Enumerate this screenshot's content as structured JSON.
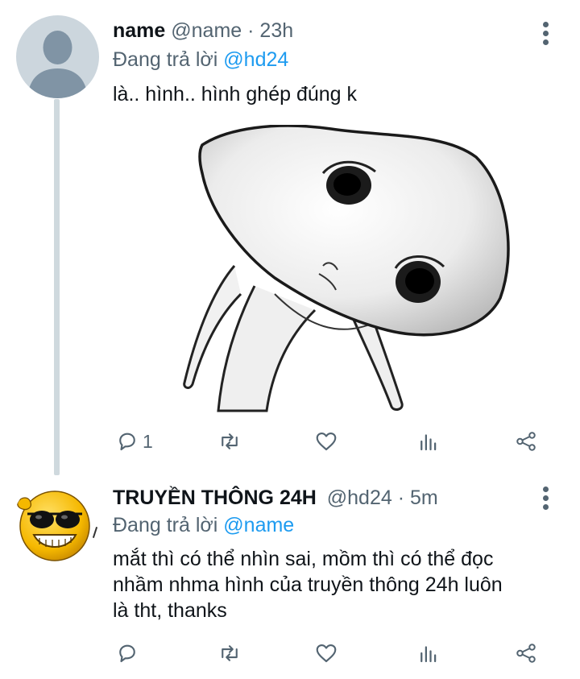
{
  "tweets": [
    {
      "name": "name",
      "handle": "@name",
      "dot": "·",
      "time": "23h",
      "reply_prefix": "Đang trả lời",
      "reply_to": "@hd24",
      "text": "là.. hình.. hình ghép đúng k",
      "reply_count": "1"
    },
    {
      "name": "TRUYỀN THÔNG 24H",
      "handle": "@hd24",
      "dot": "·",
      "time": "5m",
      "reply_prefix": "Đang trả lời",
      "reply_to": "@name",
      "text_lines": [
        "mắt thì có thể nhìn sai, mồm thì có thể đọc",
        "nhầm nhma hình của truyền thông 24h luôn",
        "là tht, thanks"
      ],
      "reply_count": ""
    }
  ],
  "icons": {
    "reply": "reply-icon",
    "retweet": "retweet-icon",
    "like": "heart-icon",
    "views": "views-icon",
    "share": "share-icon",
    "more": "more-vertical-icon"
  },
  "colors": {
    "text": "#0f1419",
    "secondary": "#536471",
    "link": "#1d9bf0",
    "thread_line": "#cfd9de"
  }
}
